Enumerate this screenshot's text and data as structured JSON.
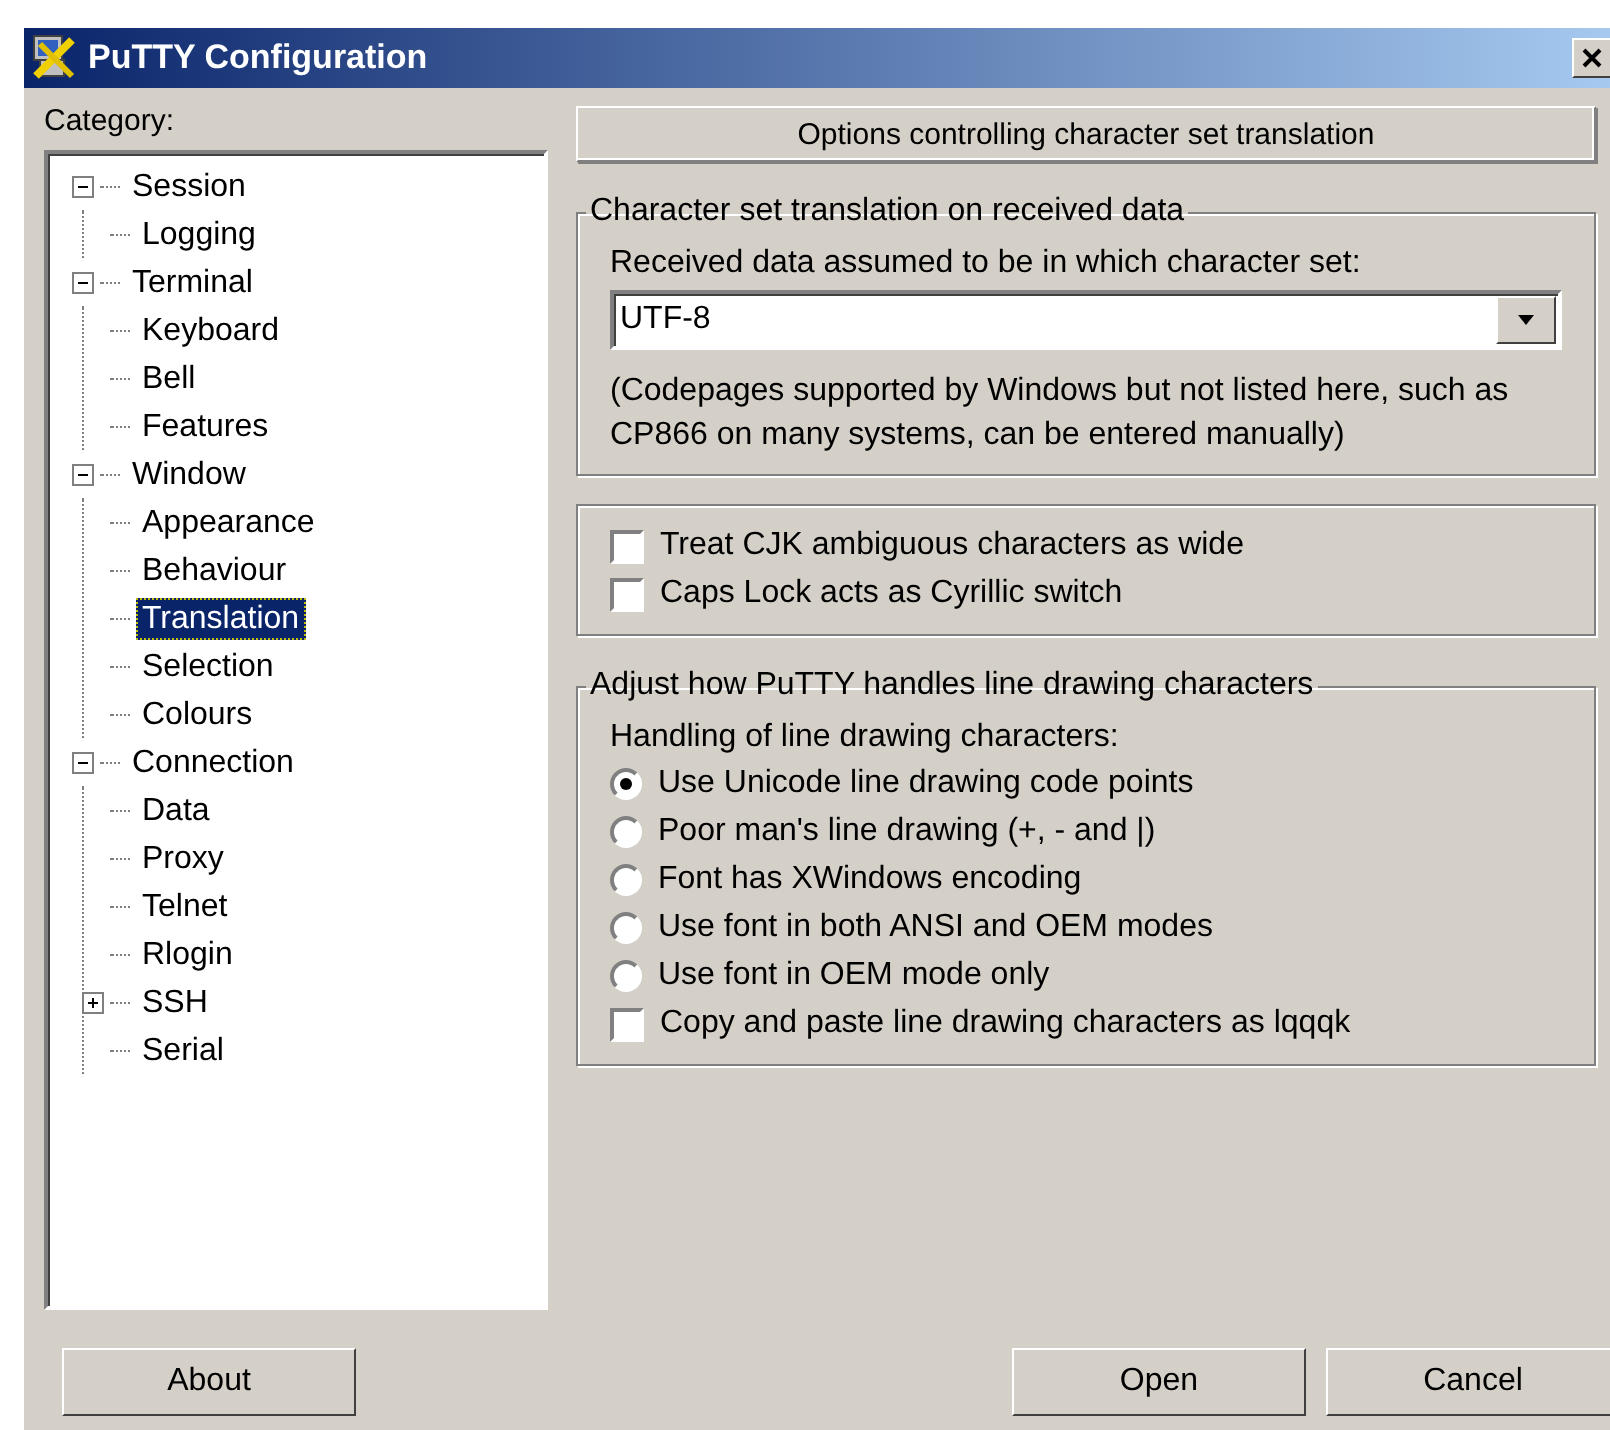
{
  "window": {
    "title": "PuTTY Configuration"
  },
  "category_label": "Category:",
  "tree": [
    {
      "label": "Session",
      "expanded": true,
      "selected": false,
      "children": [
        {
          "label": "Logging",
          "selected": false
        }
      ]
    },
    {
      "label": "Terminal",
      "expanded": true,
      "selected": false,
      "children": [
        {
          "label": "Keyboard",
          "selected": false
        },
        {
          "label": "Bell",
          "selected": false
        },
        {
          "label": "Features",
          "selected": false
        }
      ]
    },
    {
      "label": "Window",
      "expanded": true,
      "selected": false,
      "children": [
        {
          "label": "Appearance",
          "selected": false
        },
        {
          "label": "Behaviour",
          "selected": false
        },
        {
          "label": "Translation",
          "selected": true
        },
        {
          "label": "Selection",
          "selected": false
        },
        {
          "label": "Colours",
          "selected": false
        }
      ]
    },
    {
      "label": "Connection",
      "expanded": true,
      "selected": false,
      "children": [
        {
          "label": "Data",
          "selected": false
        },
        {
          "label": "Proxy",
          "selected": false
        },
        {
          "label": "Telnet",
          "selected": false
        },
        {
          "label": "Rlogin",
          "selected": false
        },
        {
          "label": "SSH",
          "expanded": false,
          "selected": false
        },
        {
          "label": "Serial",
          "selected": false
        }
      ]
    }
  ],
  "panel_header": "Options controlling character set translation",
  "groups": [
    {
      "title": "Character set translation on received data",
      "items": [
        {
          "kind": "label",
          "text": "Received data assumed to be in which character set:"
        },
        {
          "kind": "combo",
          "value": "UTF-8"
        },
        {
          "kind": "note",
          "text": "(Codepages supported by Windows but not listed here, such as CP866 on many systems, can be entered manually)"
        }
      ]
    },
    {
      "items": [
        {
          "kind": "checkbox",
          "text": "Treat CJK ambiguous characters as wide",
          "checked": false
        },
        {
          "kind": "checkbox",
          "text": "Caps Lock acts as Cyrillic switch",
          "checked": false
        }
      ]
    },
    {
      "title": "Adjust how PuTTY handles line drawing characters",
      "items": [
        {
          "kind": "label",
          "text": "Handling of line drawing characters:"
        },
        {
          "kind": "radio",
          "text": "Use Unicode line drawing code points",
          "selected": true
        },
        {
          "kind": "radio",
          "text": "Poor man's line drawing (+, - and |)",
          "selected": false
        },
        {
          "kind": "radio",
          "text": "Font has XWindows encoding",
          "selected": false
        },
        {
          "kind": "radio",
          "text": "Use font in both ANSI and OEM modes",
          "selected": false
        },
        {
          "kind": "radio",
          "text": "Use font in OEM mode only",
          "selected": false
        },
        {
          "kind": "checkbox",
          "text": "Copy and paste line drawing characters as lqqqk",
          "checked": false
        }
      ]
    }
  ],
  "buttons": {
    "left": [
      "About"
    ],
    "right": [
      "Open",
      "Cancel"
    ]
  }
}
